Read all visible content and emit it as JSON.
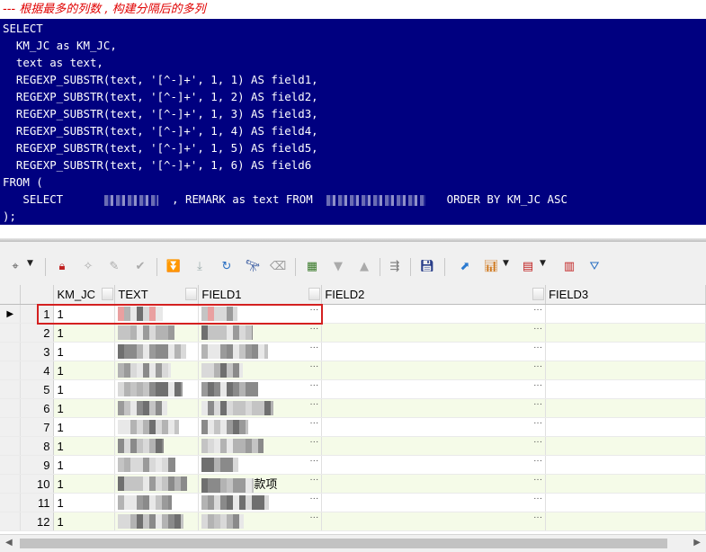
{
  "comment": "--- 根据最多的列数 , 构建分隔后的多列",
  "sql": [
    "SELECT",
    "  KM_JC as KM_JC,",
    "  text as text,",
    "  REGEXP_SUBSTR(text, '[^-]+', 1, 1) AS field1,",
    "  REGEXP_SUBSTR(text, '[^-]+', 1, 2) AS field2,",
    "  REGEXP_SUBSTR(text, '[^-]+', 1, 3) AS field3,",
    "  REGEXP_SUBSTR(text, '[^-]+', 1, 4) AS field4,",
    "  REGEXP_SUBSTR(text, '[^-]+', 1, 5) AS field5,",
    "  REGEXP_SUBSTR(text, '[^-]+', 1, 6) AS field6",
    "FROM ("
  ],
  "sql_subquery": {
    "part1": "   SELECT ",
    "part2": " , REMARK as text FROM ",
    "part3": " ORDER BY KM_JC ASC"
  },
  "sql_end": ");",
  "toolbar_icons": [
    "select-tool-icon",
    "lock-icon",
    "new-record-icon",
    "delete-record-icon",
    "post-icon",
    "fetch-next-icon",
    "fetch-last-icon",
    "refresh-icon",
    "find-icon",
    "clear-icon",
    "query-by-example-icon",
    "filter-down-icon",
    "filter-up-icon",
    "link-icon",
    "save-icon",
    "export-icon",
    "chart-icon",
    "grid-icon",
    "single-record-icon",
    "filter-icon"
  ],
  "columns": [
    "KM_JC",
    "TEXT",
    "FIELD1",
    "FIELD2",
    "FIELD3"
  ],
  "rows": [
    {
      "num": "1",
      "km_jc": "1",
      "field1_tail": ""
    },
    {
      "num": "2",
      "km_jc": "1",
      "field1_tail": ""
    },
    {
      "num": "3",
      "km_jc": "1",
      "field1_tail": ""
    },
    {
      "num": "4",
      "km_jc": "1",
      "field1_tail": ""
    },
    {
      "num": "5",
      "km_jc": "1",
      "field1_tail": ""
    },
    {
      "num": "6",
      "km_jc": "1",
      "field1_tail": ""
    },
    {
      "num": "7",
      "km_jc": "1",
      "field1_tail": ""
    },
    {
      "num": "8",
      "km_jc": "1",
      "field1_tail": ""
    },
    {
      "num": "9",
      "km_jc": "1",
      "field1_tail": ""
    },
    {
      "num": "10",
      "km_jc": "1",
      "field1_tail": "款项"
    },
    {
      "num": "11",
      "km_jc": "1",
      "field1_tail": ""
    },
    {
      "num": "12",
      "km_jc": "1",
      "field1_tail": ""
    }
  ],
  "colors": {
    "sql_bg": "#000080",
    "comment": "#e00000",
    "highlight": "#d42020",
    "row_alt": "#f5fbe8"
  }
}
